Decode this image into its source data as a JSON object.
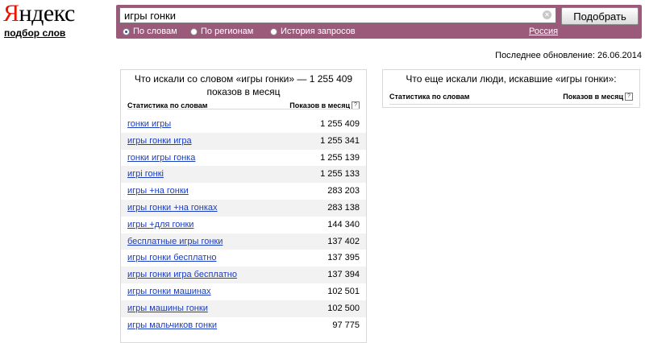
{
  "brand": {
    "logo_first": "Я",
    "logo_rest": "ндекс",
    "subtitle": "подбор слов"
  },
  "search": {
    "value": "игры гонки",
    "clear_glyph": "×",
    "button_label": "Подобрать"
  },
  "modes": [
    {
      "label": "По словам",
      "selected": true
    },
    {
      "label": "По регионам",
      "selected": false
    },
    {
      "label": "История запросов",
      "selected": false
    }
  ],
  "region": "Россия",
  "updated": "Последнее обновление: 26.06.2014",
  "left_panel": {
    "title": "Что искали со словом «игры гонки» — 1 255 409 показов в месяц",
    "col_keyword": "Статистика по словам",
    "col_count": "Показов в месяц",
    "help": "?",
    "rows": [
      {
        "kw": "гонки игры",
        "count": "1 255 409"
      },
      {
        "kw": "игры гонки игра",
        "count": "1 255 341"
      },
      {
        "kw": "гонки игры гонка",
        "count": "1 255 139"
      },
      {
        "kw": "игрі гонкі",
        "count": "1 255 133"
      },
      {
        "kw": "игры +на гонки",
        "count": "283 203"
      },
      {
        "kw": "игры гонки +на гонках",
        "count": "283 138"
      },
      {
        "kw": "игры +для гонки",
        "count": "144 340"
      },
      {
        "kw": "бесплатные игры гонки",
        "count": "137 402"
      },
      {
        "kw": "игры гонки бесплатно",
        "count": "137 395"
      },
      {
        "kw": "игры гонки игра бесплатно",
        "count": "137 394"
      },
      {
        "kw": "игры гонки машинах",
        "count": "102 501"
      },
      {
        "kw": "игры машины гонки",
        "count": "102 500"
      },
      {
        "kw": "игры мальчиков гонки",
        "count": "97 775"
      }
    ]
  },
  "right_panel": {
    "title": "Что еще искали люди, искавшие «игры гонки»:",
    "col_keyword": "Статистика по словам",
    "col_count": "Показов в месяц",
    "help": "?"
  }
}
